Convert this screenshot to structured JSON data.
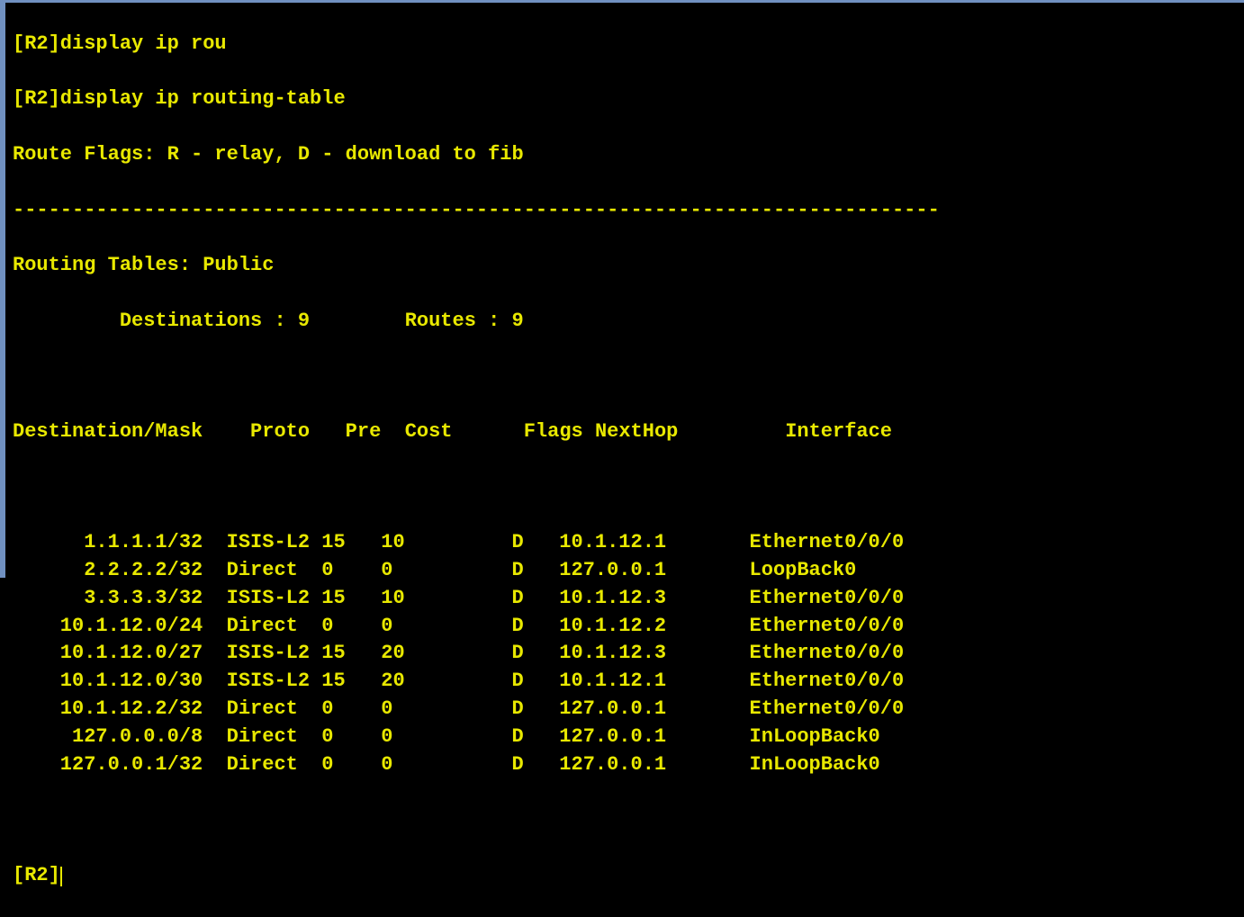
{
  "top_partial": "[R2]display ip rou",
  "cmd_line": "[R2]display ip routing-table",
  "flags_line": "Route Flags: R - relay, D - download to fib",
  "separator": "------------------------------------------------------------------------------",
  "table_title": "Routing Tables: Public",
  "dest_label": "Destinations :",
  "dest_count": "9",
  "routes_label": "Routes :",
  "routes_count": "9",
  "headers": {
    "dest": "Destination/Mask",
    "proto": "Proto",
    "pre": "Pre",
    "cost": "Cost",
    "flags": "Flags",
    "nexthop": "NextHop",
    "iface": "Interface"
  },
  "rows": [
    {
      "dest": "1.1.1.1/32",
      "proto": "ISIS-L2",
      "pre": "15",
      "cost": "10",
      "flags": "D",
      "nexthop": "10.1.12.1",
      "iface": "Ethernet0/0/0"
    },
    {
      "dest": "2.2.2.2/32",
      "proto": "Direct",
      "pre": "0",
      "cost": "0",
      "flags": "D",
      "nexthop": "127.0.0.1",
      "iface": "LoopBack0"
    },
    {
      "dest": "3.3.3.3/32",
      "proto": "ISIS-L2",
      "pre": "15",
      "cost": "10",
      "flags": "D",
      "nexthop": "10.1.12.3",
      "iface": "Ethernet0/0/0"
    },
    {
      "dest": "10.1.12.0/24",
      "proto": "Direct",
      "pre": "0",
      "cost": "0",
      "flags": "D",
      "nexthop": "10.1.12.2",
      "iface": "Ethernet0/0/0"
    },
    {
      "dest": "10.1.12.0/27",
      "proto": "ISIS-L2",
      "pre": "15",
      "cost": "20",
      "flags": "D",
      "nexthop": "10.1.12.3",
      "iface": "Ethernet0/0/0"
    },
    {
      "dest": "10.1.12.0/30",
      "proto": "ISIS-L2",
      "pre": "15",
      "cost": "20",
      "flags": "D",
      "nexthop": "10.1.12.1",
      "iface": "Ethernet0/0/0"
    },
    {
      "dest": "10.1.12.2/32",
      "proto": "Direct",
      "pre": "0",
      "cost": "0",
      "flags": "D",
      "nexthop": "127.0.0.1",
      "iface": "Ethernet0/0/0"
    },
    {
      "dest": "127.0.0.0/8",
      "proto": "Direct",
      "pre": "0",
      "cost": "0",
      "flags": "D",
      "nexthop": "127.0.0.1",
      "iface": "InLoopBack0"
    },
    {
      "dest": "127.0.0.1/32",
      "proto": "Direct",
      "pre": "0",
      "cost": "0",
      "flags": "D",
      "nexthop": "127.0.0.1",
      "iface": "InLoopBack0"
    }
  ],
  "prompt": "[R2]"
}
